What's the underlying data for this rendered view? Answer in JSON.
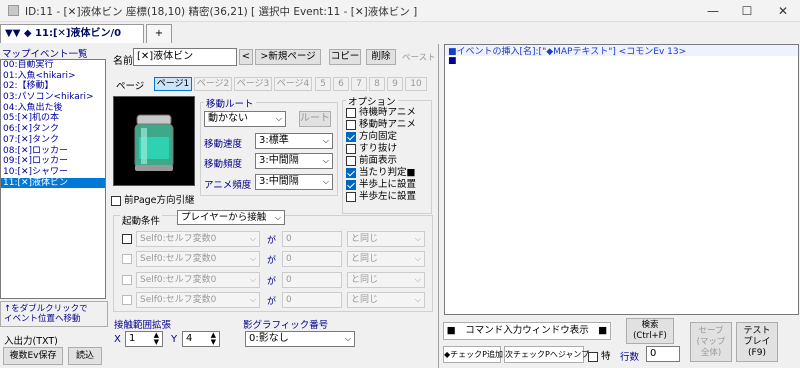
{
  "window": {
    "title": "ID:11 - [✕]液体ビン 座標(18,10) 精密(36,21) [ 選択中 Event:11 - [✕]液体ビン ]",
    "minimize": "—",
    "maximize": "☐",
    "close": "✕"
  },
  "tabs": {
    "current": "▼▼ ◆ 11:[✕]液体ビン/0",
    "add": "+"
  },
  "sidebar": {
    "header": "マップイベント一覧",
    "events": [
      "00:自動実行",
      "01:入魚<hikari>",
      "02:【移動】",
      "03:パソコン<hikari>",
      "04:入魚出た後",
      "05:[✕]机の本",
      "06:[✕]タンク",
      "07:[✕]タンク",
      "08:[✕]ロッカー",
      "09:[✕]ロッカー",
      "10:[✕]シャワー",
      "11:[✕]液体ビン"
    ],
    "selected_index": 11,
    "hint": "↑をダブルクリックで\nイベント位置へ移動",
    "io_label": "入出力(TXT)",
    "save_multi": "複数Ev保存",
    "load": "読込"
  },
  "editor": {
    "name_label": "名前",
    "name_value": "[✕]液体ビン",
    "prev": "<",
    "new_page": ">新規ページ",
    "copy": "コピー",
    "delete": "削除",
    "paste": "ペースト",
    "page_label": "ページ",
    "pages": [
      "ページ1",
      "ページ2",
      "ページ3",
      "ページ4",
      "5",
      "6",
      "7",
      "8",
      "9",
      "10"
    ],
    "dir_fix_label": "前Page方向引継"
  },
  "movement": {
    "title": "移動ルート",
    "type": "動かない",
    "route_btn": "ルート",
    "speed_label": "移動速度",
    "speed": "3:標準",
    "freq_label": "移動頻度",
    "freq": "3:中間隔",
    "anim_label": "アニメ頻度",
    "anim": "3:中間隔"
  },
  "options": {
    "title": "オプション",
    "items": [
      {
        "label": "待機時アニメ",
        "checked": false
      },
      {
        "label": "移動時アニメ",
        "checked": false
      },
      {
        "label": "方向固定",
        "checked": true
      },
      {
        "label": "すり抜け",
        "checked": false
      },
      {
        "label": "前面表示",
        "checked": false
      },
      {
        "label": "当たり判定■",
        "checked": true
      },
      {
        "label": "半歩上に設置",
        "checked": true
      },
      {
        "label": "半歩左に設置",
        "checked": false
      }
    ]
  },
  "conditions": {
    "label": "起動条件",
    "trigger": "プレイヤーから接触",
    "rows": [
      {
        "var": "Self0:セルフ変数0",
        "ga": "が",
        "val": "0",
        "cmp": "と同じ"
      },
      {
        "var": "Self0:セルフ変数0",
        "ga": "が",
        "val": "0",
        "cmp": "と同じ"
      },
      {
        "var": "Self0:セルフ変数0",
        "ga": "が",
        "val": "0",
        "cmp": "と同じ"
      },
      {
        "var": "Self0:セルフ変数0",
        "ga": "が",
        "val": "0",
        "cmp": "と同じ"
      }
    ]
  },
  "contact": {
    "label": "接触範囲拡張",
    "x_label": "X",
    "x": "1",
    "y_label": "Y",
    "y": "4"
  },
  "shadow": {
    "label": "影グラフィック番号",
    "value": "0:影なし"
  },
  "commands": {
    "line1": "■イベントの挿入[名]:[\"◆MAPテキスト\"] <コモンEv 13>",
    "line2": "■",
    "input_window": "■　コマンド入力ウィンドウ表示　■",
    "search": "検索\n(Ctrl+F)",
    "save": "セーブ\n(マップ\n全体)",
    "test": "テスト\nプレイ\n(F9)",
    "check_add": "◆チェックP追加",
    "next_check": "次チェックPへジャンプ",
    "special": "特",
    "row_label": "行数",
    "row_value": "0"
  },
  "colors": {
    "accent": "#0078d7",
    "label_blue": "#00008b",
    "cmd_blue": "#1a3cc8"
  }
}
